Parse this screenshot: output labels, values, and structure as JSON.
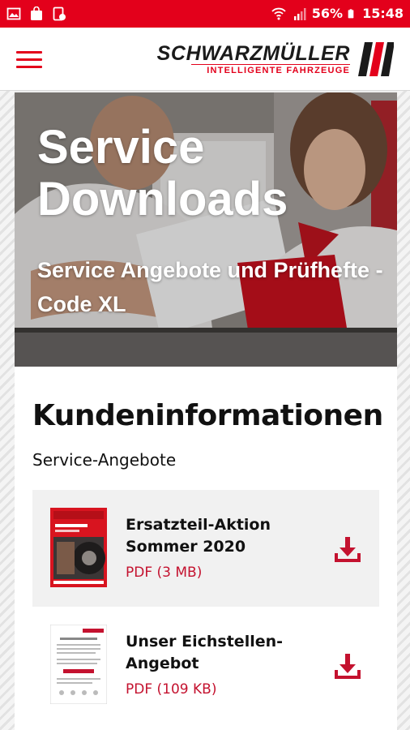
{
  "status_bar": {
    "battery": "56%",
    "time": "15:48",
    "icons": [
      "image-icon",
      "bag-icon",
      "tablet-icon",
      "wifi-icon",
      "signal-icon",
      "battery-icon"
    ]
  },
  "header": {
    "brand_name": "SCHWARZMÜLLER",
    "brand_tagline": "INTELLIGENTE FAHRZEUGE",
    "menu_icon": "hamburger-menu-icon"
  },
  "hero": {
    "title_line1": "Service",
    "title_line2": "Downloads",
    "subtitle": "Service Angebote und Prüfhefte - Code XL"
  },
  "main": {
    "section_title": "Kundeninformationen",
    "section_subtitle": "Service-Angebote",
    "downloads": [
      {
        "title": "Ersatzteil-Aktion Sommer 2020",
        "meta": "PDF (3 MB)",
        "icon": "download-icon"
      },
      {
        "title": "Unser Eichstellen-Angebot",
        "meta": "PDF (109 KB)",
        "icon": "download-icon"
      }
    ]
  },
  "colors": {
    "brand_red": "#e3001b",
    "text_red": "#c4122f",
    "item_background": "#f1f1f1"
  }
}
